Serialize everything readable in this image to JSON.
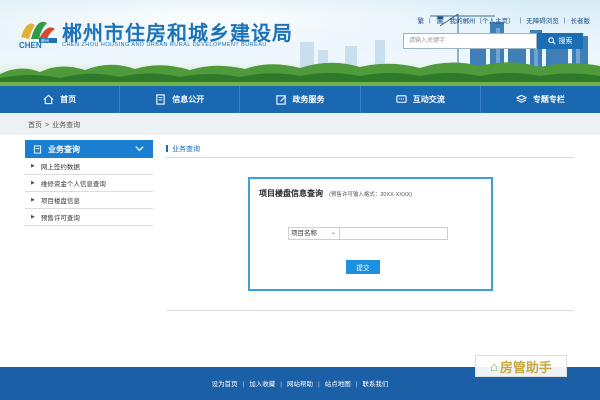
{
  "header": {
    "site_title": "郴州市住房和城乡建设局",
    "site_subtitle": "CHEN ZHOU HOUSING AND URBAN RURAL DEVELOPMENT BUREAU",
    "logo_text": "CHEN",
    "logo_small_text": "郴州",
    "links": [
      "繁",
      "我的郴州（个人主页）",
      "无障碍浏览",
      "长者版"
    ],
    "search_placeholder": "请输入关键字",
    "search_button": "搜索"
  },
  "nav": {
    "items": [
      {
        "label": "首页",
        "icon": "home-icon"
      },
      {
        "label": "信息公开",
        "icon": "document-icon"
      },
      {
        "label": "政务服务",
        "icon": "edit-icon"
      },
      {
        "label": "互动交流",
        "icon": "chat-icon"
      },
      {
        "label": "专题专栏",
        "icon": "layers-icon"
      }
    ]
  },
  "breadcrumb": {
    "home": "首页",
    "separator": ">",
    "current": "业务查询"
  },
  "sidebar": {
    "title": "业务查询",
    "items": [
      "网上签约数据",
      "维修资金个人信息查询",
      "项目楼盘信息",
      "预售许可查询"
    ]
  },
  "main": {
    "section_title": "业务查询",
    "query_title": "项目楼盘信息查询",
    "query_hint": "(预售许可输入格式：20XX-XXXX)",
    "field_option": "项目名称",
    "field_value": "",
    "submit": "提交"
  },
  "footer": {
    "links": [
      "设为首页",
      "加入收藏",
      "网站帮助",
      "站点地图",
      "联系我们"
    ]
  },
  "watermark": {
    "text": "房管助手"
  },
  "colors": {
    "brand_blue": "#1a68b2",
    "accent_blue": "#1a7fd0",
    "footer_blue": "#1b5fa6",
    "query_border": "#3aa0dc"
  }
}
